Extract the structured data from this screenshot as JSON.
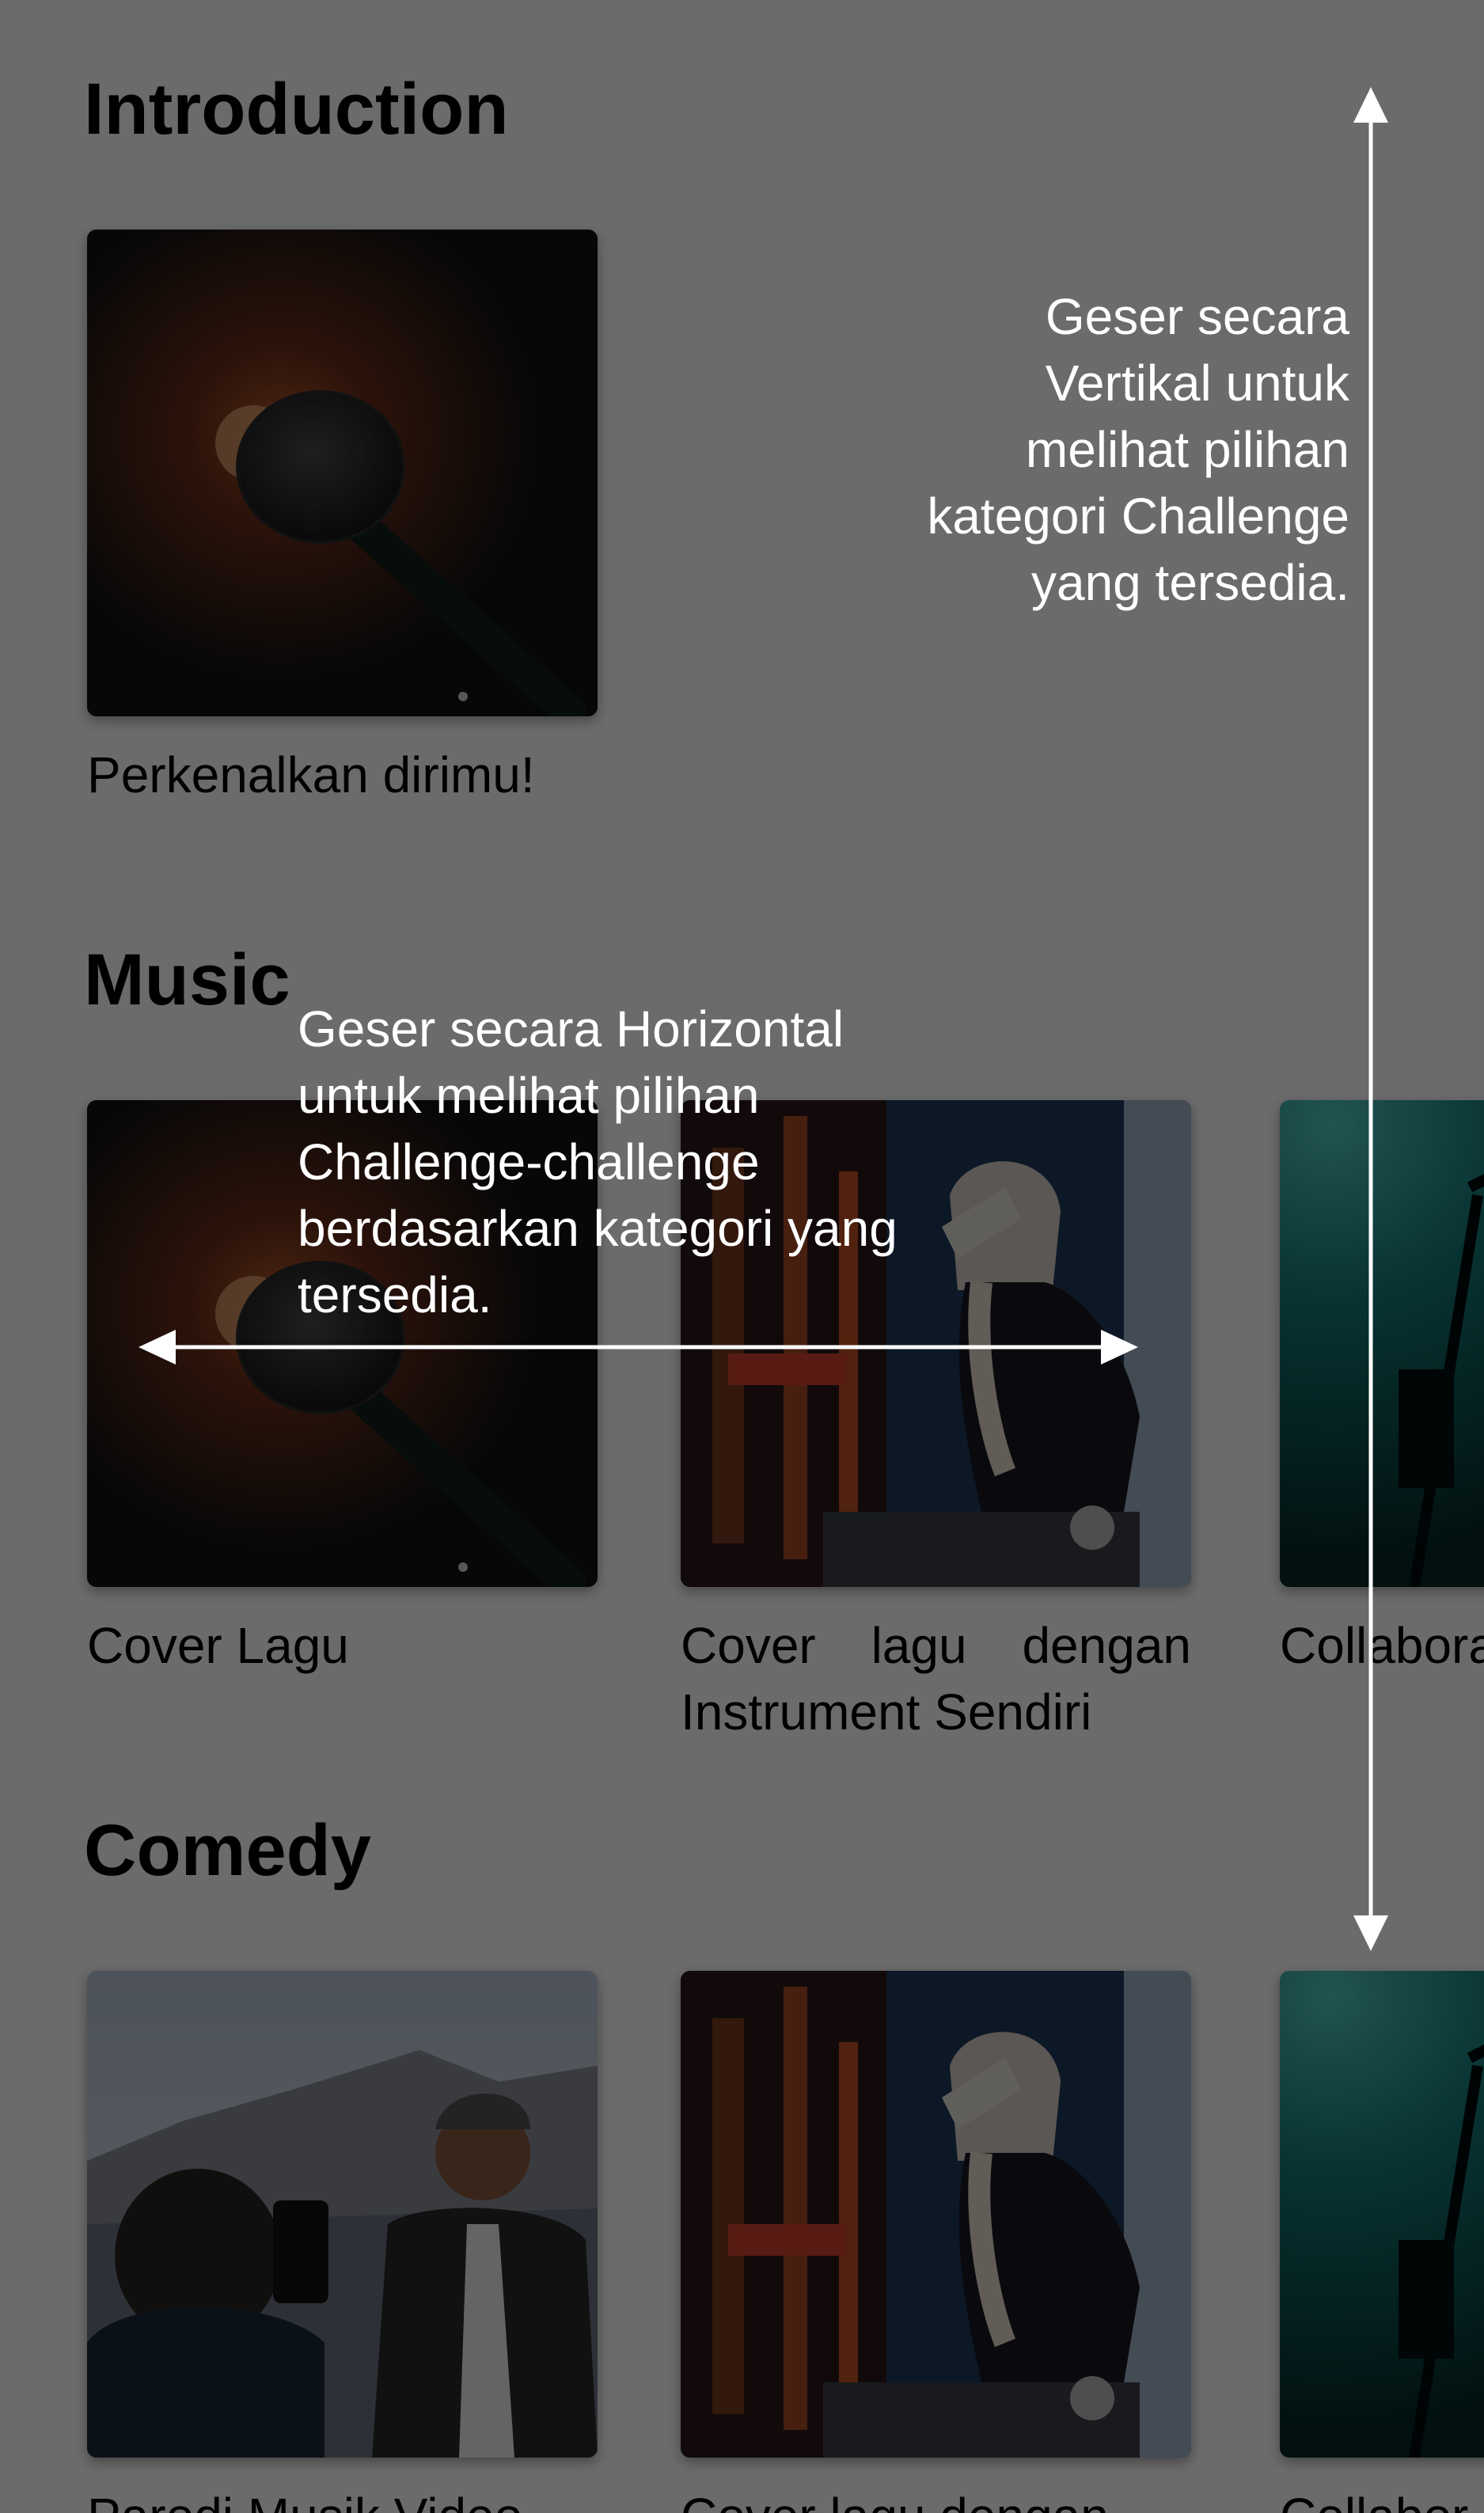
{
  "sections": [
    {
      "title": "Introduction",
      "cards": [
        {
          "title": "Perkenalkan dirimu!",
          "image": "microphone-image"
        }
      ]
    },
    {
      "title": "Music",
      "cards": [
        {
          "title": "Cover Lagu",
          "image": "microphone-image"
        },
        {
          "title": "Cover lagu dengan Instrument Sendiri",
          "image": "dj-image"
        },
        {
          "title": "Collaboration Lagu",
          "image": "stage-mic-image"
        }
      ]
    },
    {
      "title": "Comedy",
      "cards": [
        {
          "title": "Parodi Musik Video",
          "image": "selfie-image"
        },
        {
          "title": "Cover lagu dengan",
          "image": "dj-image"
        },
        {
          "title": "Collabor",
          "image": "stage-mic-image"
        }
      ]
    }
  ],
  "hints": {
    "vertical": "Geser secara Vertikal untuk melihat pilihan kategori Challenge yang tersedia.",
    "horizontal": "Geser secara Horizontal untuk melihat pilihan Challenge-challenge berdasarkan kategori yang tersedia."
  },
  "colors": {
    "overlay": "rgba(0,0,0,0.58)",
    "hint_text": "#ffffff",
    "arrow": "#ffffff"
  },
  "icons": [
    "up-arrow-icon",
    "down-arrow-icon",
    "left-arrow-icon",
    "right-arrow-icon"
  ]
}
